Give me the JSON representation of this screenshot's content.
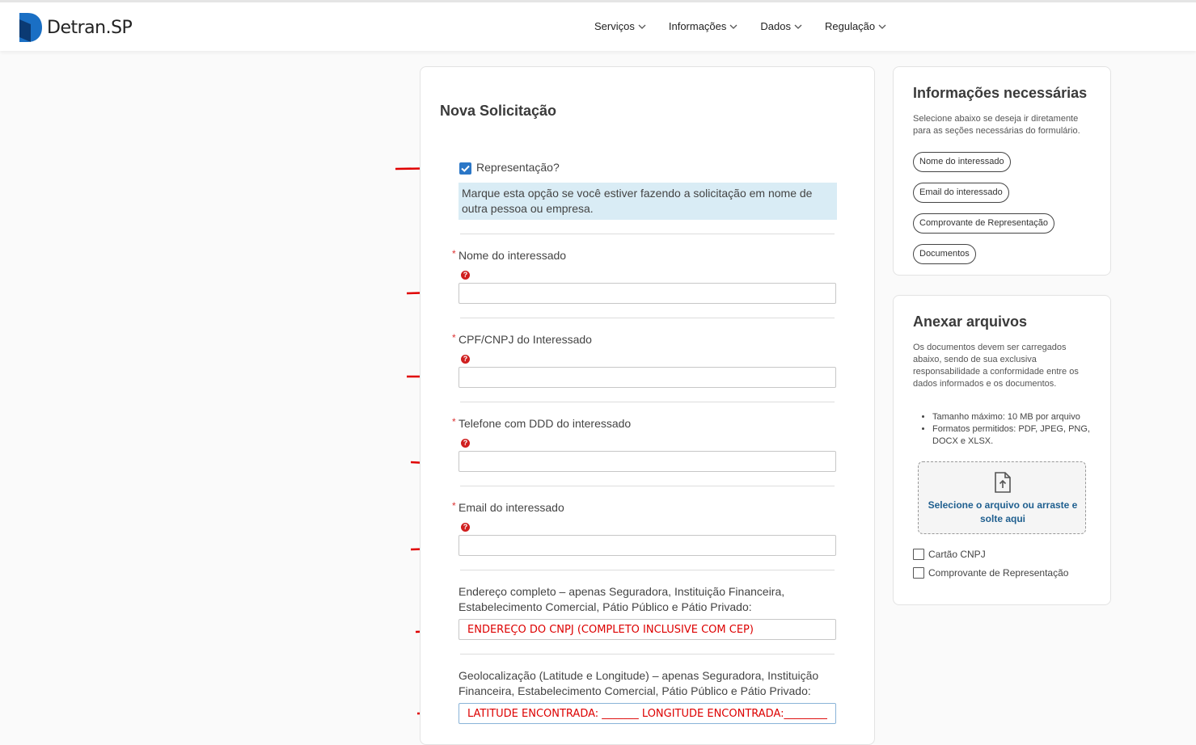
{
  "header": {
    "logo_text": "Detran.SP",
    "nav": [
      "Serviços",
      "Informações",
      "Dados",
      "Regulação"
    ]
  },
  "form": {
    "title": "Nova Solicitação",
    "representacao_label": "Representação?",
    "representacao_checked": true,
    "representacao_help": "Marque esta opção se você estiver fazendo a solicitação em nome de outra pessoa ou empresa.",
    "required_mark": "*",
    "help_glyph": "?",
    "fields": {
      "nome": {
        "label": "Nome do interessado",
        "value": ""
      },
      "cpf": {
        "label": "CPF/CNPJ do Interessado",
        "value": ""
      },
      "telefone": {
        "label": "Telefone com DDD do interessado",
        "value": ""
      },
      "email": {
        "label": "Email do interessado",
        "value": ""
      },
      "endereco": {
        "label": "Endereço completo – apenas Seguradora, Instituição Financeira, Estabelecimento Comercial, Pátio Público e Pátio Privado:",
        "value": "ENDEREÇO DO CNPJ (COMPLETO INCLUSIVE COM CEP)"
      },
      "geo": {
        "label": "Geolocalização (Latitude e Longitude) – apenas Seguradora, Instituição Financeira, Estabelecimento Comercial, Pátio Público e Pátio Privado:",
        "value": "LATITUDE ENCONTRADA: _______ LONGITUDE ENCONTRADA:__________"
      }
    }
  },
  "sidebar_info": {
    "title": "Informações necessárias",
    "text": "Selecione abaixo se deseja ir diretamente para as seções necessárias do formulário.",
    "links": [
      "Nome do interessado",
      "Email do interessado",
      "Comprovante de Representação",
      "Documentos"
    ]
  },
  "sidebar_attach": {
    "title": "Anexar arquivos",
    "text": "Os documentos devem ser carregados abaixo, sendo de sua exclusiva responsabilidade a conformidade entre os dados informados e os documentos.",
    "bullets": [
      "Tamanho máximo: 10 MB por arquivo",
      "Formatos permitidos: PDF, JPEG, PNG, DOCX e XLSX."
    ],
    "drop_text": "Selecione o arquivo ou arraste e solte aqui",
    "checkboxes": [
      "Cartão CNPJ",
      "Comprovante de Representação"
    ]
  },
  "colors": {
    "accent": "#2b77c7",
    "annotation": "#e00000",
    "info_bg": "#d9ecf5"
  }
}
